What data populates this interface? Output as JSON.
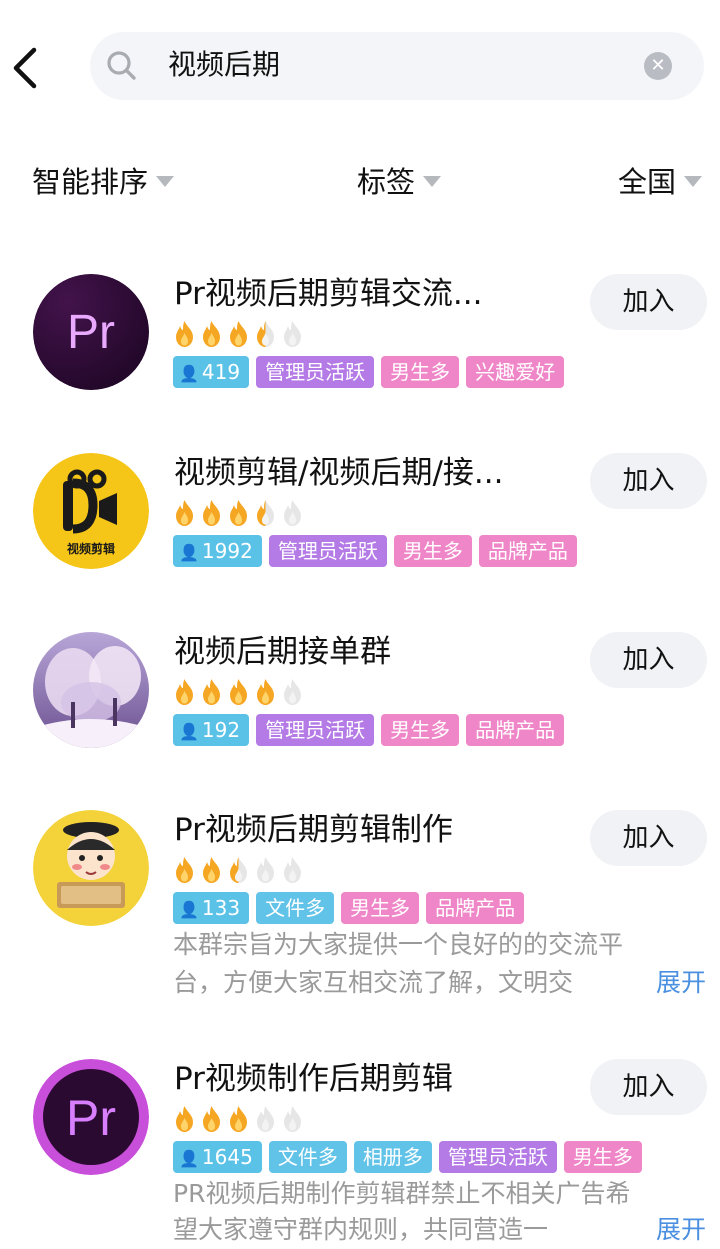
{
  "search": {
    "query": "视频后期"
  },
  "filters": {
    "sort": "智能排序",
    "tag": "标签",
    "region": "全国"
  },
  "colors": {
    "tag_members": "#5bc2e7",
    "tag_purple": "#b47ae6",
    "tag_pink": "#ef86c8",
    "tag_blue": "#62c3e8",
    "flame_active": "#f5a623",
    "expand_link": "#4a8fe0"
  },
  "groups": [
    {
      "name": "Pr视频后期剪辑交流...",
      "avatar_icon": "premiere-pro-logo-icon",
      "rating": 3.5,
      "members": "419",
      "tags": [
        {
          "label": "管理员活跃",
          "color": "purple"
        },
        {
          "label": "男生多",
          "color": "pink"
        },
        {
          "label": "兴趣爱好",
          "color": "pink"
        }
      ],
      "join_label": "加入"
    },
    {
      "name": "视频剪辑/视频后期/接...",
      "avatar_icon": "video-edit-logo-icon",
      "avatar_text": "视频剪辑",
      "rating": 3.5,
      "members": "1992",
      "tags": [
        {
          "label": "管理员活跃",
          "color": "purple"
        },
        {
          "label": "男生多",
          "color": "pink"
        },
        {
          "label": "品牌产品",
          "color": "pink"
        }
      ],
      "join_label": "加入"
    },
    {
      "name": "视频后期接单群",
      "avatar_icon": "snowy-trees-photo-icon",
      "rating": 4,
      "members": "192",
      "tags": [
        {
          "label": "管理员活跃",
          "color": "purple"
        },
        {
          "label": "男生多",
          "color": "pink"
        },
        {
          "label": "品牌产品",
          "color": "pink"
        }
      ],
      "join_label": "加入"
    },
    {
      "name": "Pr视频后期剪辑制作",
      "avatar_icon": "cartoon-character-icon",
      "rating": 2.5,
      "members": "133",
      "tags": [
        {
          "label": "文件多",
          "color": "blue"
        },
        {
          "label": "男生多",
          "color": "pink"
        },
        {
          "label": "品牌产品",
          "color": "pink"
        }
      ],
      "desc_line1": "本群宗旨为大家提供一个良好的的交流平",
      "desc_line2": "台，方便大家互相交流了解，文明交",
      "expand_label": "展开",
      "join_label": "加入"
    },
    {
      "name": "Pr视频制作后期剪辑",
      "avatar_icon": "premiere-pro-logo-icon",
      "rating": 3,
      "members": "1645",
      "tags": [
        {
          "label": "文件多",
          "color": "blue"
        },
        {
          "label": "相册多",
          "color": "blue"
        },
        {
          "label": "管理员活跃",
          "color": "purple"
        },
        {
          "label": "男生多",
          "color": "pink"
        }
      ],
      "desc_line1": "PR视频后期制作剪辑群禁止不相关广告希",
      "desc_line2": "望大家遵守群内规则，共同营造一",
      "expand_label": "展开",
      "join_label": "加入"
    }
  ]
}
